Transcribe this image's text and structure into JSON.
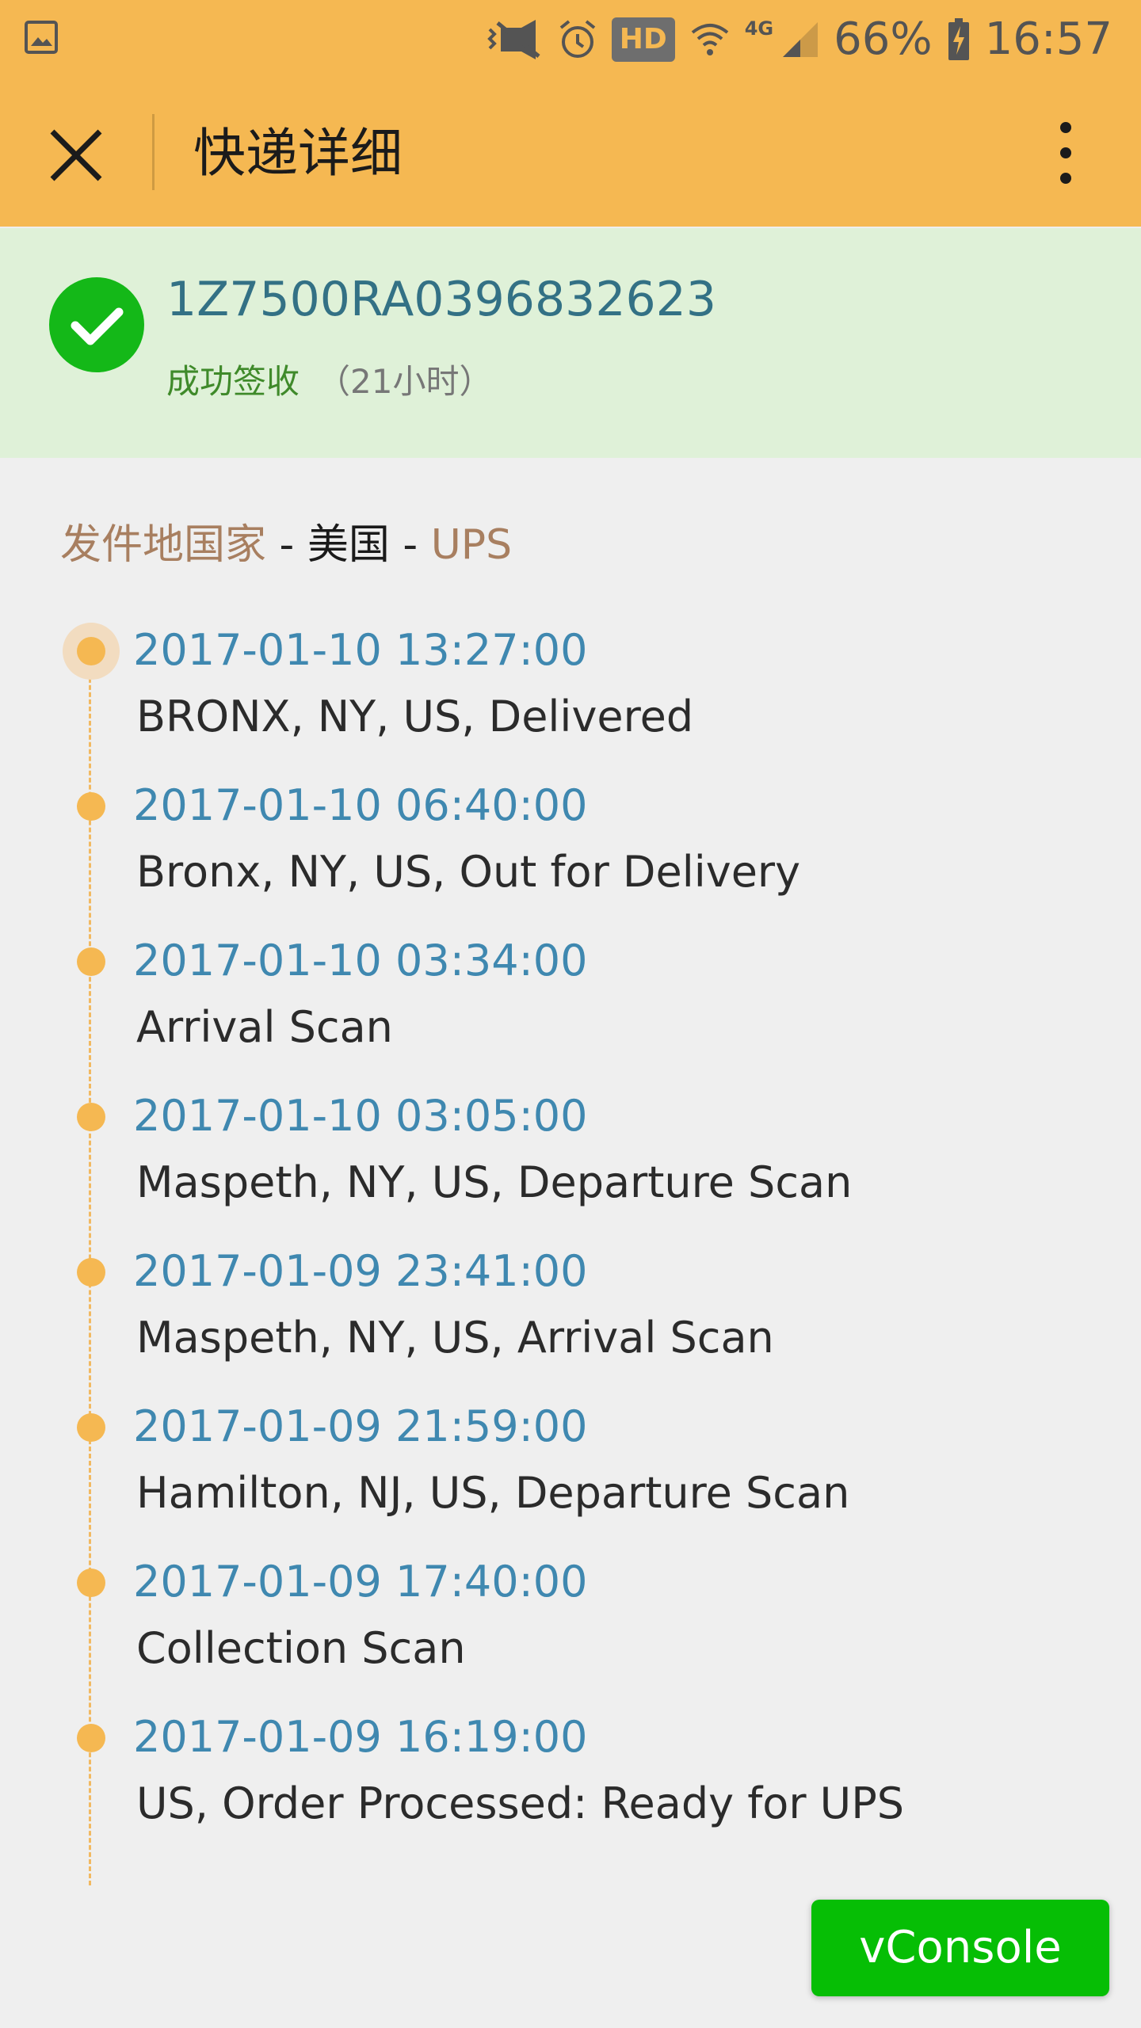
{
  "status_bar": {
    "icons": [
      "image-icon",
      "vibrate-icon",
      "alarm-icon",
      "hd-badge",
      "wifi-icon",
      "network-icon",
      "signal-icon",
      "battery-charging-icon"
    ],
    "hd_label": "HD",
    "network_label": "4G",
    "battery": "66%",
    "time": "16:57"
  },
  "nav": {
    "title": "快递详细",
    "close_icon": "close-icon",
    "more_icon": "more-vertical-icon"
  },
  "summary": {
    "tracking_number": "1Z7500RA0396832623",
    "status": "成功签收",
    "duration": "（21小时）",
    "status_icon": "check-circle-icon",
    "status_color": "#14b818"
  },
  "origin": {
    "label": "发件地国家",
    "sep1": " - ",
    "country": "美国",
    "sep2": " - ",
    "carrier": "UPS"
  },
  "events": [
    {
      "time": "2017-01-10 13:27:00",
      "desc": "BRONX, NY, US, Delivered"
    },
    {
      "time": "2017-01-10 06:40:00",
      "desc": "Bronx, NY, US, Out for Delivery"
    },
    {
      "time": "2017-01-10 03:34:00",
      "desc": "Arrival Scan"
    },
    {
      "time": "2017-01-10 03:05:00",
      "desc": "Maspeth, NY, US, Departure Scan"
    },
    {
      "time": "2017-01-09 23:41:00",
      "desc": "Maspeth, NY, US, Arrival Scan"
    },
    {
      "time": "2017-01-09 21:59:00",
      "desc": "Hamilton, NJ, US, Departure Scan"
    },
    {
      "time": "2017-01-09 17:40:00",
      "desc": "Collection Scan"
    },
    {
      "time": "2017-01-09 16:19:00",
      "desc": "US, Order Processed: Ready for UPS"
    }
  ],
  "vconsole": {
    "label": "vConsole"
  },
  "colors": {
    "header": "#f5b852",
    "banner": "#dff1d8",
    "timeline_accent": "#f5b852",
    "event_time": "#3f88b0",
    "vconsole": "#06be05"
  }
}
